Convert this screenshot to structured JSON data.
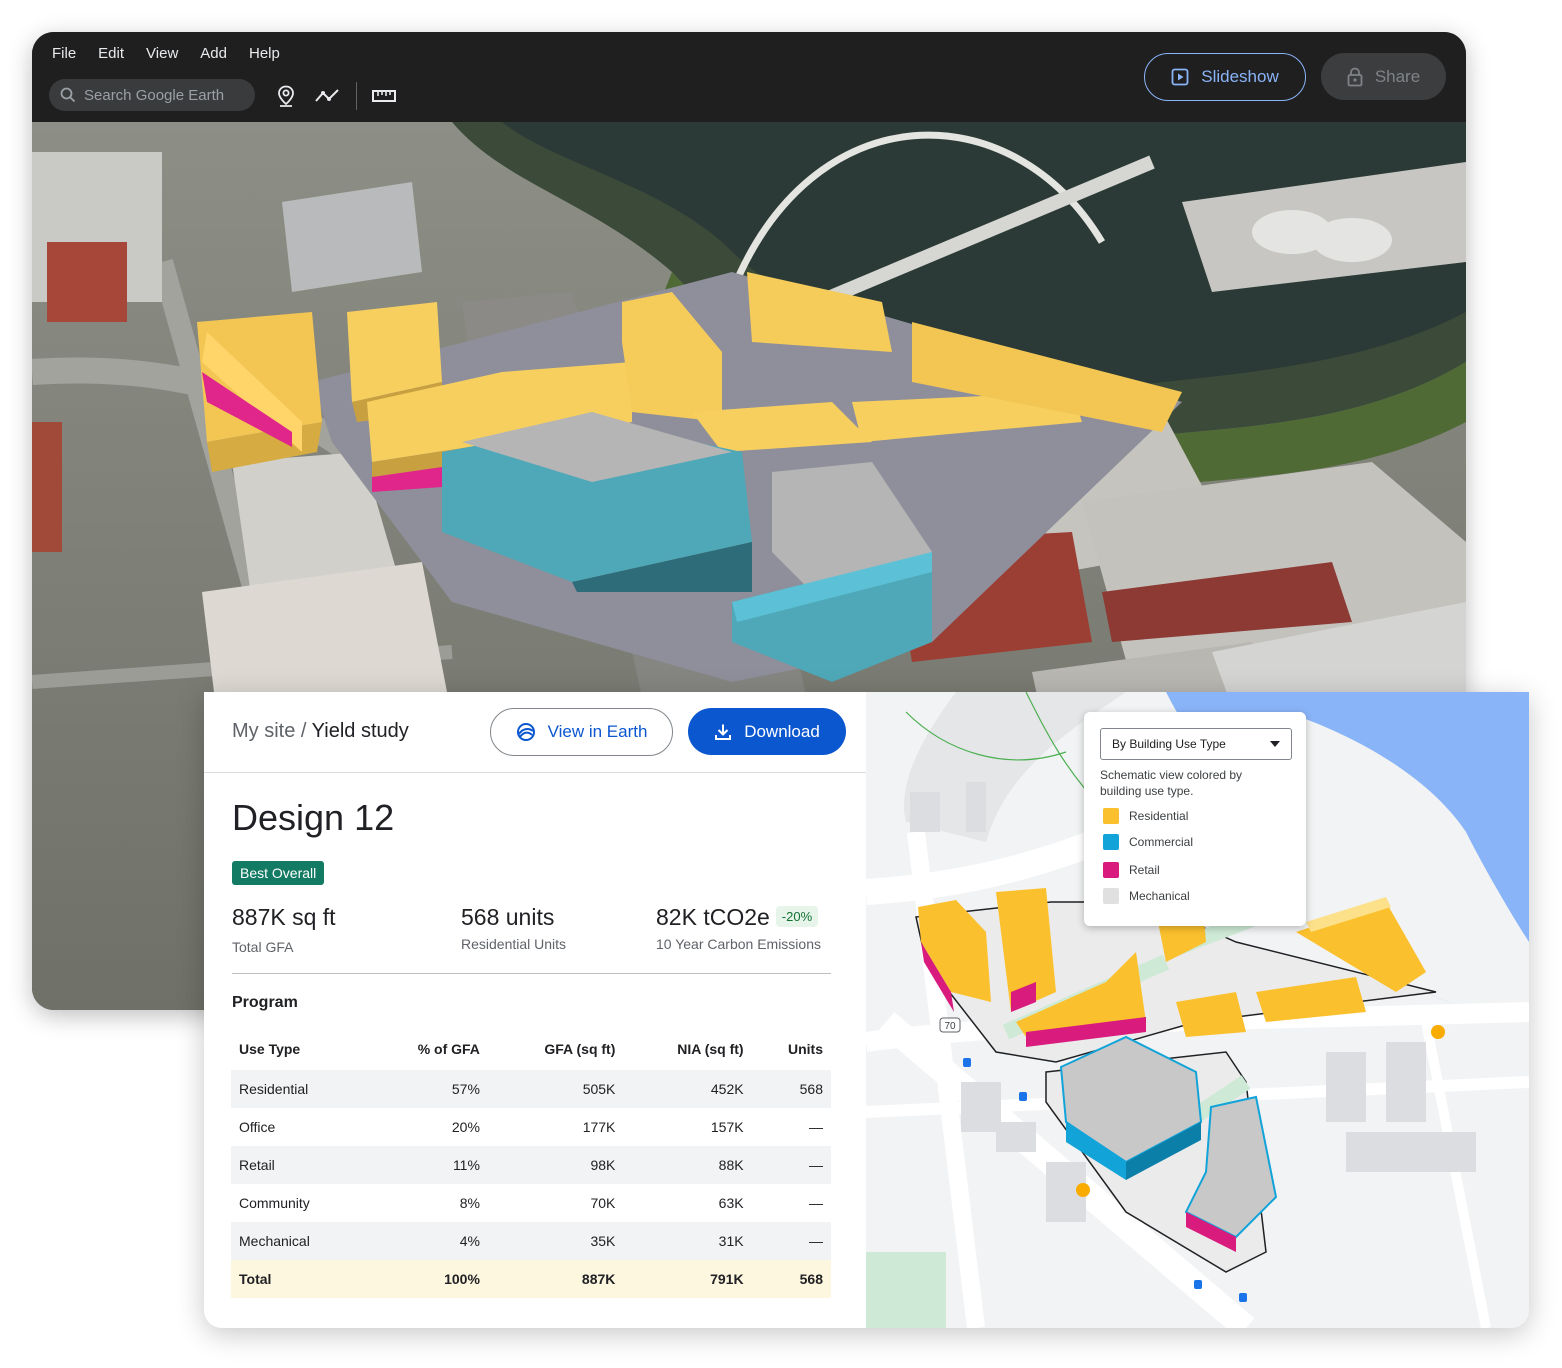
{
  "menu": [
    "File",
    "Edit",
    "View",
    "Add",
    "Help"
  ],
  "search": {
    "placeholder": "Search Google Earth"
  },
  "toolbar": {
    "slideshow_label": "Slideshow",
    "share_label": "Share"
  },
  "report": {
    "breadcrumb_parent": "My site /",
    "breadcrumb_current": "Yield study",
    "view_in_earth_label": "View in Earth",
    "download_label": "Download",
    "design_title": "Design 12",
    "badge": "Best Overall",
    "metrics": [
      {
        "value": "887K sq ft",
        "label": "Total GFA"
      },
      {
        "value": "568 units",
        "label": "Residential Units"
      },
      {
        "value": "82K tCO2e",
        "chip": "-20%",
        "label": "10 Year Carbon Emissions"
      }
    ],
    "program_label": "Program",
    "table": {
      "headers": [
        "Use Type",
        "% of GFA",
        "GFA (sq ft)",
        "NIA (sq ft)",
        "Units"
      ],
      "rows": [
        [
          "Residential",
          "57%",
          "505K",
          "452K",
          "568"
        ],
        [
          "Office",
          "20%",
          "177K",
          "157K",
          "—"
        ],
        [
          "Retail",
          "11%",
          "98K",
          "88K",
          "—"
        ],
        [
          "Community",
          "8%",
          "70K",
          "63K",
          "—"
        ],
        [
          "Mechanical",
          "4%",
          "35K",
          "31K",
          "—"
        ]
      ],
      "total": [
        "Total",
        "100%",
        "887K",
        "791K",
        "568"
      ]
    }
  },
  "legend": {
    "select_value": "By Building Use Type",
    "description": "Schematic view colored by building use type.",
    "items": [
      {
        "label": "Residential",
        "color": "#fbc02d"
      },
      {
        "label": "Commercial",
        "color": "#12a4d9"
      },
      {
        "label": "Retail",
        "color": "#d81b7d"
      },
      {
        "label": "Mechanical",
        "color": "#e0e0e0"
      }
    ]
  },
  "map_labels": {
    "route_shield": "70"
  }
}
